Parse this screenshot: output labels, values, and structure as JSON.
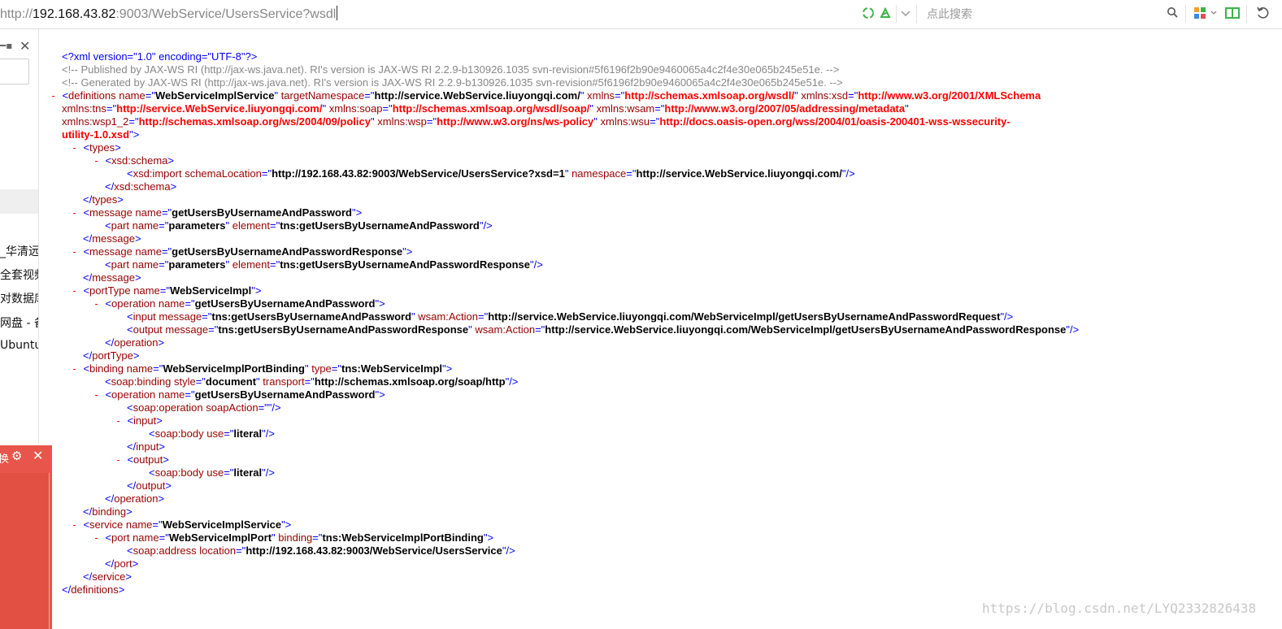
{
  "address_bar": {
    "url_protocol": "http://",
    "url_host": "192.168.43.82",
    "url_rest": ":9003/WebService/UsersService?wsdl",
    "search_placeholder": "点此搜索"
  },
  "sidebar": {
    "items": [
      "_华清远",
      "全套视频",
      "对数据库",
      "网盘 - 备",
      "Ubuntu"
    ]
  },
  "float_panel": {
    "label": "换"
  },
  "xml": {
    "decl": "<?xml version=\"1.0\" encoding=\"UTF-8\"?>",
    "comment1": "<!-- Published by JAX-WS RI (http://jax-ws.java.net). RI's version is JAX-WS RI 2.2.9-b130926.1035 svn-revision#5f6196f2b90e9460065a4c2f4e30e065b245e51e. -->",
    "comment2": "<!-- Generated by JAX-WS RI (http://jax-ws.java.net). RI's version is JAX-WS RI 2.2.9-b130926.1035 svn-revision#5f6196f2b90e9460065a4c2f4e30e065b245e51e. -->",
    "def_name": "WebServiceImplService",
    "def_target": "http://service.WebService.liuyongqi.com/",
    "def_xmlns": "http://schemas.xmlsoap.org/wsdl/",
    "def_xsd": "http://www.w3.org/2001/XMLSchema",
    "def_tns": "http://service.WebService.liuyongqi.com/",
    "def_soap": "http://schemas.xmlsoap.org/wsdl/soap/",
    "def_wsam": "http://www.w3.org/2007/05/addressing/metadata",
    "def_wsp1": "http://schemas.xmlsoap.org/ws/2004/09/policy",
    "def_wsp": "http://www.w3.org/ns/ws-policy",
    "def_wsu": "http://docs.oasis-open.org/wss/2004/01/oasis-200401-wss-wssecurity-",
    "def_wsu2": "utility-1.0.xsd",
    "import_loc": "http://192.168.43.82:9003/WebService/UsersService?xsd=1",
    "import_ns": "http://service.WebService.liuyongqi.com/",
    "msg1_name": "getUsersByUsernameAndPassword",
    "msg1_part": "parameters",
    "msg1_el": "tns:getUsersByUsernameAndPassword",
    "msg2_name": "getUsersByUsernameAndPasswordResponse",
    "msg2_part": "parameters",
    "msg2_el": "tns:getUsersByUsernameAndPasswordResponse",
    "pt_name": "WebServiceImpl",
    "op_name": "getUsersByUsernameAndPassword",
    "in_msg": "tns:getUsersByUsernameAndPassword",
    "in_action": "http://service.WebService.liuyongqi.com/WebServiceImpl/getUsersByUsernameAndPasswordRequest",
    "out_msg": "tns:getUsersByUsernameAndPasswordResponse",
    "out_action": "http://service.WebService.liuyongqi.com/WebServiceImpl/getUsersByUsernameAndPasswordResponse",
    "bind_name": "WebServiceImplPortBinding",
    "bind_type": "tns:WebServiceImpl",
    "soapbind_style": "document",
    "soapbind_transport": "http://schemas.xmlsoap.org/soap/http",
    "bop_name": "getUsersByUsernameAndPassword",
    "soap_action": "",
    "body_use_in": "literal",
    "body_use_out": "literal",
    "svc_name": "WebServiceImplService",
    "port_name": "WebServiceImplPort",
    "port_binding": "tns:WebServiceImplPortBinding",
    "addr_loc": "http://192.168.43.82:9003/WebService/UsersService"
  },
  "watermark": "https://blog.csdn.net/LYQ2332826438"
}
